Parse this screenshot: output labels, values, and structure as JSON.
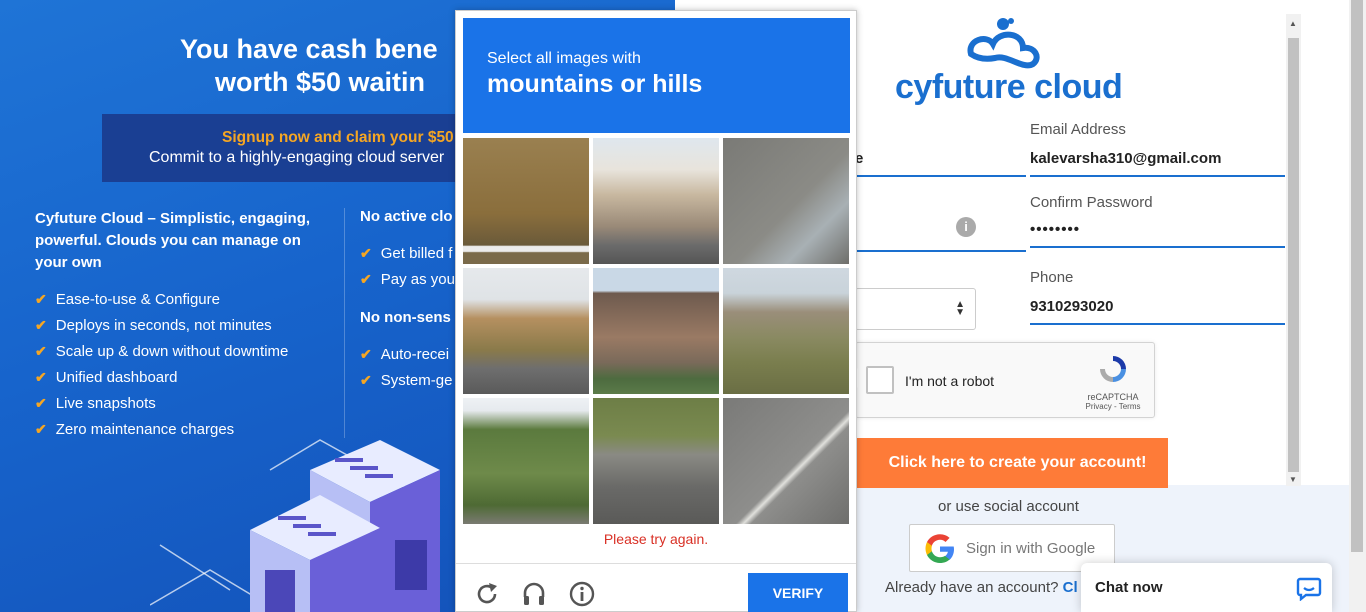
{
  "promo": {
    "headline_line1": "You have cash bene",
    "headline_line2": "worth $50 waitin",
    "banner_highlight": "Signup now and claim your $50",
    "banner_sub": "Commit to a highly-engaging cloud server",
    "features_title": "Cyfuture Cloud – Simplistic, engaging, powerful. Clouds you can manage on your own",
    "features": [
      "Ease-to-use & Configure",
      "Deploys in seconds, not minutes",
      "Scale up & down without downtime",
      "Unified dashboard",
      "Live snapshots",
      "Zero maintenance charges"
    ],
    "col2_title1": "No active clo",
    "col2_list1": [
      "Get billed f",
      "Pay as you"
    ],
    "col2_title2": "No non-sens",
    "col2_list2": [
      "Auto-recei",
      "System-ge"
    ],
    "check_glyph": "✔"
  },
  "brand": {
    "name": "cyfuture cloud",
    "color": "#1a6fcf"
  },
  "form": {
    "name_partial": "e",
    "email_label": "Email Address",
    "email_value": "kalevarsha310@gmail.com",
    "confirm_password_label": "Confirm Password",
    "confirm_password_value": "••••••••",
    "info_glyph": "i",
    "phone_label": "Phone",
    "phone_value": "9310293020",
    "recaptcha_label": "I'm not a robot",
    "recaptcha_brand": "reCAPTCHA",
    "recaptcha_links": "Privacy - Terms",
    "create_button": "Click here to create your account!",
    "social_text": "or use social account",
    "google_button": "Sign in with Google",
    "already_text": "Already have an account?",
    "already_link": "Cl"
  },
  "chat": {
    "label": "Chat now"
  },
  "challenge": {
    "prompt_small": "Select all images with",
    "prompt_large": "mountains or hills",
    "error": "Please try again.",
    "verify_button": "VERIFY",
    "accent": "#1a73e8"
  }
}
